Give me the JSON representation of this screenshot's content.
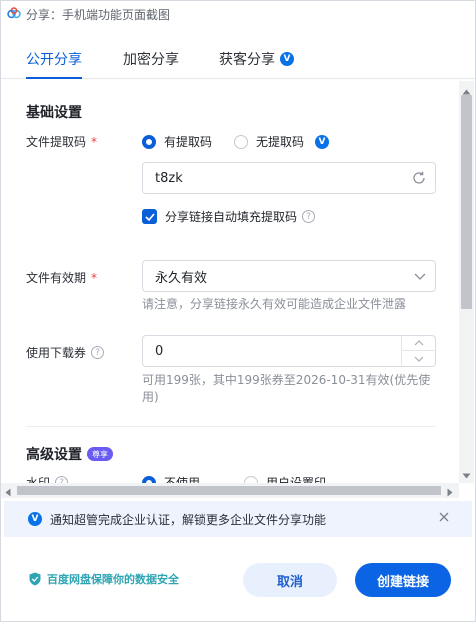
{
  "window": {
    "title": "分享：手机端功能页面截图"
  },
  "tabs": [
    {
      "label": "公开分享"
    },
    {
      "label": "加密分享"
    },
    {
      "label": "获客分享"
    }
  ],
  "basic_settings": {
    "title": "基础设置",
    "extraction_code": {
      "label": "文件提取码",
      "required_mark": "*",
      "options": [
        "有提取码",
        "无提取码"
      ],
      "selected": "有提取码",
      "value": "t8zk",
      "auto_fill_label": "分享链接自动填充提取码",
      "auto_fill_checked": true
    },
    "validity": {
      "label": "文件有效期",
      "required_mark": "*",
      "value": "永久有效",
      "hint": "请注意，分享链接永久有效可能造成企业文件泄露"
    },
    "voucher": {
      "label": "使用下载券",
      "value": "0",
      "hint": "可用199张，其中199张券至2026-10-31有效(优先使用)"
    }
  },
  "advanced_settings": {
    "title": "高级设置",
    "badge": "尊享",
    "partial_label": "水印",
    "partial_option1": "不使用",
    "partial_option2": "用户设置印"
  },
  "notice": {
    "text": "通知超管完成企业认证，解锁更多企业文件分享功能"
  },
  "footer": {
    "secure_text": "百度网盘保障你的数据安全",
    "cancel_label": "取消",
    "create_label": "创建链接"
  },
  "colors": {
    "accent": "#0a5fd8",
    "badge_purple": "#6a5cf2",
    "required": "#e8453c",
    "secure_green": "#2fa5b3"
  }
}
